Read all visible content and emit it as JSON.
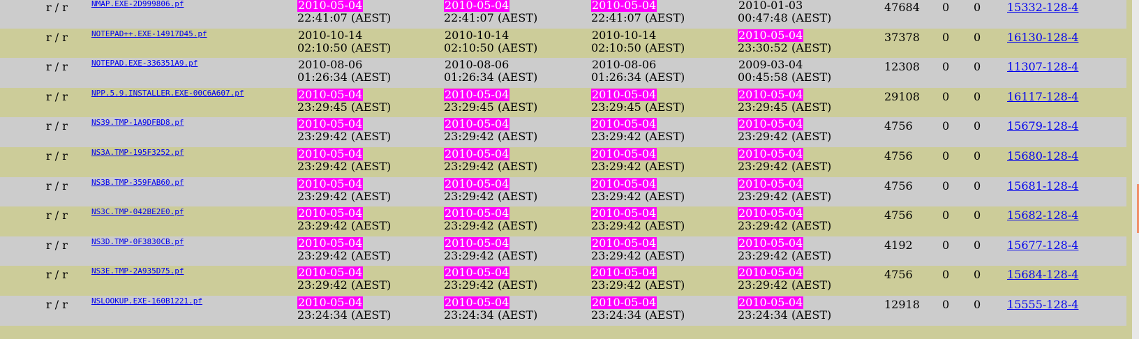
{
  "colors": {
    "highlight_bg": "#ff00ff",
    "highlight_fg": "#ffffff",
    "row_grey": "#cccccc",
    "row_olive": "#cccc99",
    "link": "#0000ee"
  },
  "files": [
    {
      "type": "r / r",
      "name": "NMAP.EXE-2D999806.pf",
      "times": [
        {
          "date": "2010-05-04",
          "time": "22:41:07 (AEST)",
          "highlight": true
        },
        {
          "date": "2010-05-04",
          "time": "22:41:07 (AEST)",
          "highlight": true
        },
        {
          "date": "2010-05-04",
          "time": "22:41:07 (AEST)",
          "highlight": true
        },
        {
          "date": "2010-01-03",
          "time": "00:47:48 (AEST)",
          "highlight": false
        }
      ],
      "size": "47684",
      "uid": "0",
      "gid": "0",
      "meta": "15332-128-4"
    },
    {
      "type": "r / r",
      "name": "NOTEPAD++.EXE-14917D45.pf",
      "times": [
        {
          "date": "2010-10-14",
          "time": "02:10:50 (AEST)",
          "highlight": false
        },
        {
          "date": "2010-10-14",
          "time": "02:10:50 (AEST)",
          "highlight": false
        },
        {
          "date": "2010-10-14",
          "time": "02:10:50 (AEST)",
          "highlight": false
        },
        {
          "date": "2010-05-04",
          "time": "23:30:52 (AEST)",
          "highlight": true
        }
      ],
      "size": "37378",
      "uid": "0",
      "gid": "0",
      "meta": "16130-128-4"
    },
    {
      "type": "r / r",
      "name": "NOTEPAD.EXE-336351A9.pf",
      "times": [
        {
          "date": "2010-08-06",
          "time": "01:26:34 (AEST)",
          "highlight": false
        },
        {
          "date": "2010-08-06",
          "time": "01:26:34 (AEST)",
          "highlight": false
        },
        {
          "date": "2010-08-06",
          "time": "01:26:34 (AEST)",
          "highlight": false
        },
        {
          "date": "2009-03-04",
          "time": "00:45:58 (AEST)",
          "highlight": false
        }
      ],
      "size": "12308",
      "uid": "0",
      "gid": "0",
      "meta": "11307-128-4"
    },
    {
      "type": "r / r",
      "name": "NPP.5.9.INSTALLER.EXE-00C6A607.pf",
      "times": [
        {
          "date": "2010-05-04",
          "time": "23:29:45 (AEST)",
          "highlight": true
        },
        {
          "date": "2010-05-04",
          "time": "23:29:45 (AEST)",
          "highlight": true
        },
        {
          "date": "2010-05-04",
          "time": "23:29:45 (AEST)",
          "highlight": true
        },
        {
          "date": "2010-05-04",
          "time": "23:29:45 (AEST)",
          "highlight": true
        }
      ],
      "size": "29108",
      "uid": "0",
      "gid": "0",
      "meta": "16117-128-4"
    },
    {
      "type": "r / r",
      "name": "NS39.TMP-1A9DFBD8.pf",
      "times": [
        {
          "date": "2010-05-04",
          "time": "23:29:42 (AEST)",
          "highlight": true
        },
        {
          "date": "2010-05-04",
          "time": "23:29:42 (AEST)",
          "highlight": true
        },
        {
          "date": "2010-05-04",
          "time": "23:29:42 (AEST)",
          "highlight": true
        },
        {
          "date": "2010-05-04",
          "time": "23:29:42 (AEST)",
          "highlight": true
        }
      ],
      "size": "4756",
      "uid": "0",
      "gid": "0",
      "meta": "15679-128-4"
    },
    {
      "type": "r / r",
      "name": "NS3A.TMP-195F3252.pf",
      "times": [
        {
          "date": "2010-05-04",
          "time": "23:29:42 (AEST)",
          "highlight": true
        },
        {
          "date": "2010-05-04",
          "time": "23:29:42 (AEST)",
          "highlight": true
        },
        {
          "date": "2010-05-04",
          "time": "23:29:42 (AEST)",
          "highlight": true
        },
        {
          "date": "2010-05-04",
          "time": "23:29:42 (AEST)",
          "highlight": true
        }
      ],
      "size": "4756",
      "uid": "0",
      "gid": "0",
      "meta": "15680-128-4"
    },
    {
      "type": "r / r",
      "name": "NS3B.TMP-359FAB60.pf",
      "times": [
        {
          "date": "2010-05-04",
          "time": "23:29:42 (AEST)",
          "highlight": true
        },
        {
          "date": "2010-05-04",
          "time": "23:29:42 (AEST)",
          "highlight": true
        },
        {
          "date": "2010-05-04",
          "time": "23:29:42 (AEST)",
          "highlight": true
        },
        {
          "date": "2010-05-04",
          "time": "23:29:42 (AEST)",
          "highlight": true
        }
      ],
      "size": "4756",
      "uid": "0",
      "gid": "0",
      "meta": "15681-128-4"
    },
    {
      "type": "r / r",
      "name": "NS3C.TMP-042BE2E0.pf",
      "times": [
        {
          "date": "2010-05-04",
          "time": "23:29:42 (AEST)",
          "highlight": true
        },
        {
          "date": "2010-05-04",
          "time": "23:29:42 (AEST)",
          "highlight": true
        },
        {
          "date": "2010-05-04",
          "time": "23:29:42 (AEST)",
          "highlight": true
        },
        {
          "date": "2010-05-04",
          "time": "23:29:42 (AEST)",
          "highlight": true
        }
      ],
      "size": "4756",
      "uid": "0",
      "gid": "0",
      "meta": "15682-128-4"
    },
    {
      "type": "r / r",
      "name": "NS3D.TMP-0F3830CB.pf",
      "times": [
        {
          "date": "2010-05-04",
          "time": "23:29:42 (AEST)",
          "highlight": true
        },
        {
          "date": "2010-05-04",
          "time": "23:29:42 (AEST)",
          "highlight": true
        },
        {
          "date": "2010-05-04",
          "time": "23:29:42 (AEST)",
          "highlight": true
        },
        {
          "date": "2010-05-04",
          "time": "23:29:42 (AEST)",
          "highlight": true
        }
      ],
      "size": "4192",
      "uid": "0",
      "gid": "0",
      "meta": "15677-128-4"
    },
    {
      "type": "r / r",
      "name": "NS3E.TMP-2A935D75.pf",
      "times": [
        {
          "date": "2010-05-04",
          "time": "23:29:42 (AEST)",
          "highlight": true
        },
        {
          "date": "2010-05-04",
          "time": "23:29:42 (AEST)",
          "highlight": true
        },
        {
          "date": "2010-05-04",
          "time": "23:29:42 (AEST)",
          "highlight": true
        },
        {
          "date": "2010-05-04",
          "time": "23:29:42 (AEST)",
          "highlight": true
        }
      ],
      "size": "4756",
      "uid": "0",
      "gid": "0",
      "meta": "15684-128-4"
    },
    {
      "type": "r / r",
      "name": "NSLOOKUP.EXE-160B1221.pf",
      "times": [
        {
          "date": "2010-05-04",
          "time": "23:24:34 (AEST)",
          "highlight": true
        },
        {
          "date": "2010-05-04",
          "time": "23:24:34 (AEST)",
          "highlight": true
        },
        {
          "date": "2010-05-04",
          "time": "23:24:34 (AEST)",
          "highlight": true
        },
        {
          "date": "2010-05-04",
          "time": "23:24:34 (AEST)",
          "highlight": true
        }
      ],
      "size": "12918",
      "uid": "0",
      "gid": "0",
      "meta": "15555-128-4"
    }
  ]
}
